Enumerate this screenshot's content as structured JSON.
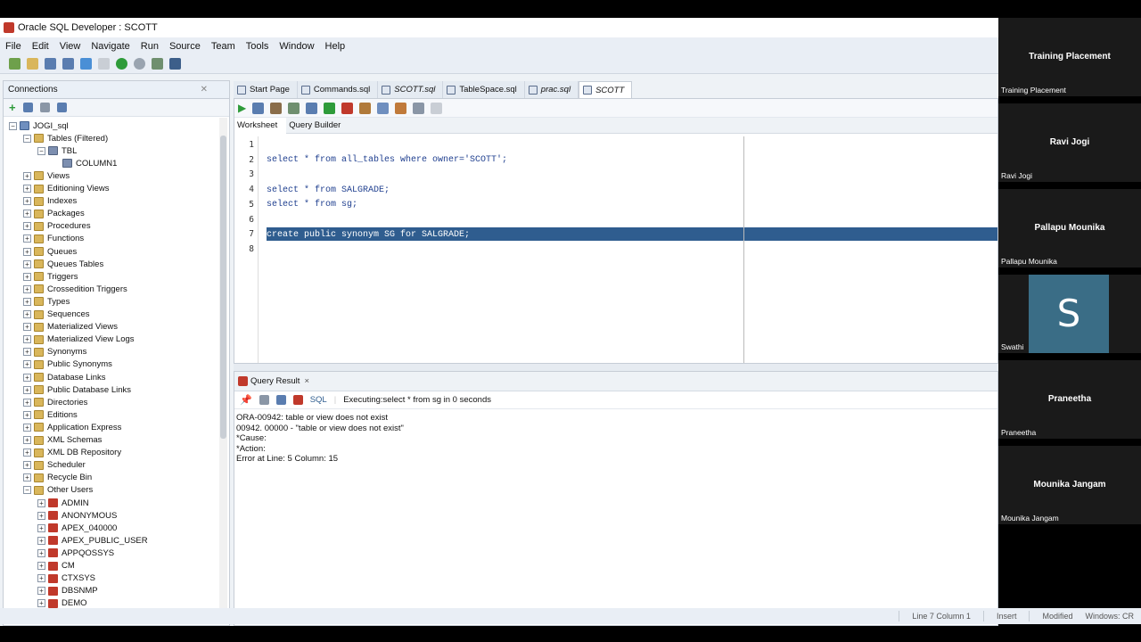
{
  "window": {
    "title": "Oracle SQL Developer : SCOTT"
  },
  "menu": [
    "File",
    "Edit",
    "View",
    "Navigate",
    "Run",
    "Source",
    "Team",
    "Tools",
    "Window",
    "Help"
  ],
  "connections": {
    "title": "Connections",
    "tree": [
      {
        "label": "JOGI_sql",
        "level": 0,
        "icon": "db",
        "exp": "-"
      },
      {
        "label": "Tables (Filtered)",
        "level": 1,
        "icon": "folder",
        "exp": "-"
      },
      {
        "label": "TBL",
        "level": 2,
        "icon": "table",
        "exp": "-"
      },
      {
        "label": "COLUMN1",
        "level": 3,
        "icon": "table",
        "exp": ""
      },
      {
        "label": "Views",
        "level": 1,
        "icon": "folder",
        "exp": "+"
      },
      {
        "label": "Editioning Views",
        "level": 1,
        "icon": "folder",
        "exp": "+"
      },
      {
        "label": "Indexes",
        "level": 1,
        "icon": "folder",
        "exp": "+"
      },
      {
        "label": "Packages",
        "level": 1,
        "icon": "folder",
        "exp": "+"
      },
      {
        "label": "Procedures",
        "level": 1,
        "icon": "folder",
        "exp": "+"
      },
      {
        "label": "Functions",
        "level": 1,
        "icon": "folder",
        "exp": "+"
      },
      {
        "label": "Queues",
        "level": 1,
        "icon": "folder",
        "exp": "+"
      },
      {
        "label": "Queues Tables",
        "level": 1,
        "icon": "folder",
        "exp": "+"
      },
      {
        "label": "Triggers",
        "level": 1,
        "icon": "folder",
        "exp": "+"
      },
      {
        "label": "Crossedition Triggers",
        "level": 1,
        "icon": "folder",
        "exp": "+"
      },
      {
        "label": "Types",
        "level": 1,
        "icon": "folder",
        "exp": "+"
      },
      {
        "label": "Sequences",
        "level": 1,
        "icon": "folder",
        "exp": "+"
      },
      {
        "label": "Materialized Views",
        "level": 1,
        "icon": "folder",
        "exp": "+"
      },
      {
        "label": "Materialized View Logs",
        "level": 1,
        "icon": "folder",
        "exp": "+"
      },
      {
        "label": "Synonyms",
        "level": 1,
        "icon": "folder",
        "exp": "+"
      },
      {
        "label": "Public Synonyms",
        "level": 1,
        "icon": "folder",
        "exp": "+"
      },
      {
        "label": "Database Links",
        "level": 1,
        "icon": "folder",
        "exp": "+"
      },
      {
        "label": "Public Database Links",
        "level": 1,
        "icon": "folder",
        "exp": "+"
      },
      {
        "label": "Directories",
        "level": 1,
        "icon": "folder",
        "exp": "+"
      },
      {
        "label": "Editions",
        "level": 1,
        "icon": "folder",
        "exp": "+"
      },
      {
        "label": "Application Express",
        "level": 1,
        "icon": "folder",
        "exp": "+"
      },
      {
        "label": "XML Schemas",
        "level": 1,
        "icon": "folder",
        "exp": "+"
      },
      {
        "label": "XML DB Repository",
        "level": 1,
        "icon": "folder",
        "exp": "+"
      },
      {
        "label": "Scheduler",
        "level": 1,
        "icon": "folder",
        "exp": "+"
      },
      {
        "label": "Recycle Bin",
        "level": 1,
        "icon": "folder",
        "exp": "+"
      },
      {
        "label": "Other Users",
        "level": 1,
        "icon": "folder",
        "exp": "-"
      },
      {
        "label": "ADMIN",
        "level": 2,
        "icon": "user",
        "exp": "+"
      },
      {
        "label": "ANONYMOUS",
        "level": 2,
        "icon": "user",
        "exp": "+"
      },
      {
        "label": "APEX_040000",
        "level": 2,
        "icon": "user",
        "exp": "+"
      },
      {
        "label": "APEX_PUBLIC_USER",
        "level": 2,
        "icon": "user",
        "exp": "+"
      },
      {
        "label": "APPQOSSYS",
        "level": 2,
        "icon": "user",
        "exp": "+"
      },
      {
        "label": "CM",
        "level": 2,
        "icon": "user",
        "exp": "+"
      },
      {
        "label": "CTXSYS",
        "level": 2,
        "icon": "user",
        "exp": "+"
      },
      {
        "label": "DBSNMP",
        "level": 2,
        "icon": "user",
        "exp": "+"
      },
      {
        "label": "DEMO",
        "level": 2,
        "icon": "user",
        "exp": "+"
      }
    ]
  },
  "tabs": [
    {
      "label": "Start Page",
      "italic": false,
      "active": false
    },
    {
      "label": "Commands.sql",
      "italic": false,
      "active": false
    },
    {
      "label": "SCOTT.sql",
      "italic": true,
      "active": false
    },
    {
      "label": "TableSpace.sql",
      "italic": false,
      "active": false
    },
    {
      "label": "prac.sql",
      "italic": true,
      "active": false
    },
    {
      "label": "SCOTT",
      "italic": true,
      "active": true
    }
  ],
  "editor": {
    "subtabs": [
      "Worksheet",
      "Query Builder"
    ],
    "lines": [
      {
        "n": "1",
        "text": ""
      },
      {
        "n": "2",
        "text": "select * from all_tables where owner='SCOTT';"
      },
      {
        "n": "3",
        "text": ""
      },
      {
        "n": "4",
        "text": "select * from SALGRADE;"
      },
      {
        "n": "5",
        "text": "select * from sg;"
      },
      {
        "n": "6",
        "text": ""
      },
      {
        "n": "7",
        "text": "create public synonym SG for SALGRADE;"
      },
      {
        "n": "8",
        "text": ""
      }
    ]
  },
  "results": {
    "tab_label": "Query Result",
    "sql_label": "SQL",
    "status": "Executing:select * from sg in 0 seconds",
    "output": [
      "ORA-00942: table or view does not exist",
      "00942. 00000 -  \"table or view does not exist\"",
      "*Cause:",
      "*Action:",
      "Error at Line: 5 Column: 15"
    ]
  },
  "statusbar": {
    "position": "Line 7 Column 1",
    "mode": "Insert",
    "modified": "Modified",
    "platform": "Windows: CR"
  },
  "participants": [
    {
      "name": "Training Placement",
      "label": "Training Placement",
      "avatar": ""
    },
    {
      "name": "Ravi Jogi",
      "label": "Ravi Jogi",
      "avatar": ""
    },
    {
      "name": "Pallapu Mounika",
      "label": "Pallapu Mounika",
      "avatar": ""
    },
    {
      "name": "",
      "label": "Swathi",
      "avatar": "S"
    },
    {
      "name": "Praneetha",
      "label": "Praneetha",
      "avatar": ""
    },
    {
      "name": "Mounika Jangam",
      "label": "Mounika Jangam",
      "avatar": ""
    }
  ],
  "colors": {
    "selection": "#2f5d8f",
    "keyword": "#1f3f8f",
    "avatar_bg": "#3a6d86"
  }
}
